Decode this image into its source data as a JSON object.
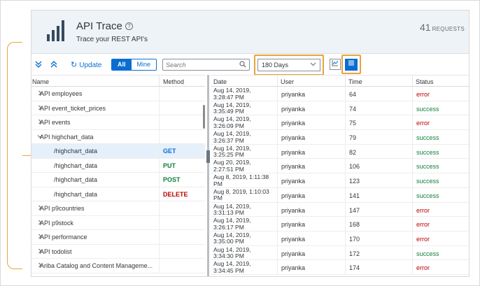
{
  "header": {
    "title": "API Trace",
    "subtitle": "Trace your REST API's",
    "request_count": "41",
    "request_label": "REQUESTS"
  },
  "toolbar": {
    "update_label": "Update",
    "filter_all": "All",
    "filter_mine": "Mine",
    "search_placeholder": "Search",
    "range_selected": "180 Days"
  },
  "left_table": {
    "columns": [
      "Name",
      "Method"
    ],
    "rows": [
      {
        "name": "API employees",
        "method": "",
        "expanded": false
      },
      {
        "name": "API event_ticket_prices",
        "method": "",
        "expanded": false
      },
      {
        "name": "API events",
        "method": "",
        "expanded": false
      },
      {
        "name": "API highchart_data",
        "method": "",
        "expanded": true
      },
      {
        "name": "/highchart_data",
        "method": "GET",
        "child": true,
        "selected": true
      },
      {
        "name": "/highchart_data",
        "method": "PUT",
        "child": true
      },
      {
        "name": "/highchart_data",
        "method": "POST",
        "child": true
      },
      {
        "name": "/highchart_data",
        "method": "DELETE",
        "child": true
      },
      {
        "name": "API p9countries",
        "method": "",
        "expanded": false
      },
      {
        "name": "API p9stock",
        "method": "",
        "expanded": false
      },
      {
        "name": "API performance",
        "method": "",
        "expanded": false
      },
      {
        "name": "API todolist",
        "method": "",
        "expanded": false
      },
      {
        "name": "Ariba Catalog and Content Manageme...",
        "method": "",
        "expanded": false
      }
    ]
  },
  "right_table": {
    "columns": [
      "Date",
      "User",
      "Time",
      "Status"
    ],
    "rows": [
      {
        "date1": "Aug 14, 2019,",
        "date2": "3:28:47 PM",
        "user": "priyanka",
        "time": "64",
        "status": "error"
      },
      {
        "date1": "Aug 14, 2019,",
        "date2": "3:35:49 PM",
        "user": "priyanka",
        "time": "74",
        "status": "success"
      },
      {
        "date1": "Aug 14, 2019,",
        "date2": "3:26:09 PM",
        "user": "priyanka",
        "time": "75",
        "status": "error"
      },
      {
        "date1": "Aug 14, 2019,",
        "date2": "3:26:37 PM",
        "user": "priyanka",
        "time": "79",
        "status": "success"
      },
      {
        "date1": "Aug 14, 2019,",
        "date2": "3:25:25 PM",
        "user": "priyanka",
        "time": "82",
        "status": "success"
      },
      {
        "date1": "Aug 20, 2019,",
        "date2": "2:27:51 PM",
        "user": "priyanka",
        "time": "106",
        "status": "success"
      },
      {
        "date1": "Aug 8, 2019, 1:11:38",
        "date2": "PM",
        "user": "priyanka",
        "time": "123",
        "status": "success"
      },
      {
        "date1": "Aug 8, 2019, 1:10:03",
        "date2": "PM",
        "user": "priyanka",
        "time": "141",
        "status": "success"
      },
      {
        "date1": "Aug 14, 2019,",
        "date2": "3:31:13 PM",
        "user": "priyanka",
        "time": "147",
        "status": "error"
      },
      {
        "date1": "Aug 14, 2019,",
        "date2": "3:26:17 PM",
        "user": "priyanka",
        "time": "168",
        "status": "error"
      },
      {
        "date1": "Aug 14, 2019,",
        "date2": "3:35:00 PM",
        "user": "priyanka",
        "time": "170",
        "status": "error"
      },
      {
        "date1": "Aug 14, 2019,",
        "date2": "3:34:30 PM",
        "user": "priyanka",
        "time": "172",
        "status": "success"
      },
      {
        "date1": "Aug 14, 2019,",
        "date2": "3:34:45 PM",
        "user": "priyanka",
        "time": "174",
        "status": "error"
      }
    ]
  }
}
